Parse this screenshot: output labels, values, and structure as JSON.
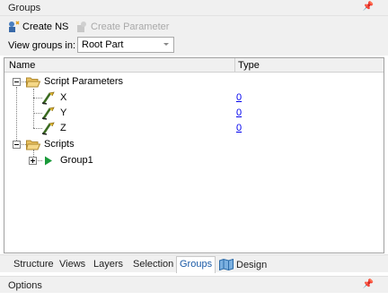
{
  "panel": {
    "title": "Groups"
  },
  "toolbar": {
    "create_ns": "Create NS",
    "create_parameter": "Create Parameter"
  },
  "view": {
    "label": "View groups in:",
    "selected": "Root Part"
  },
  "tree": {
    "col_name": "Name",
    "col_type": "Type",
    "script_parameters": "Script Parameters",
    "params": [
      {
        "name": "X",
        "type": "0"
      },
      {
        "name": "Y",
        "type": "0"
      },
      {
        "name": "Z",
        "type": "0"
      }
    ],
    "scripts": "Scripts",
    "group1": "Group1"
  },
  "tabs": [
    "Structure",
    "Views",
    "Layers",
    "Selection",
    "Groups",
    "Design"
  ],
  "active_tab": "Groups",
  "options": {
    "title": "Options"
  },
  "colors": {
    "folder": "#e8c060",
    "play": "#1a9a3a",
    "link": "#0000ee"
  }
}
